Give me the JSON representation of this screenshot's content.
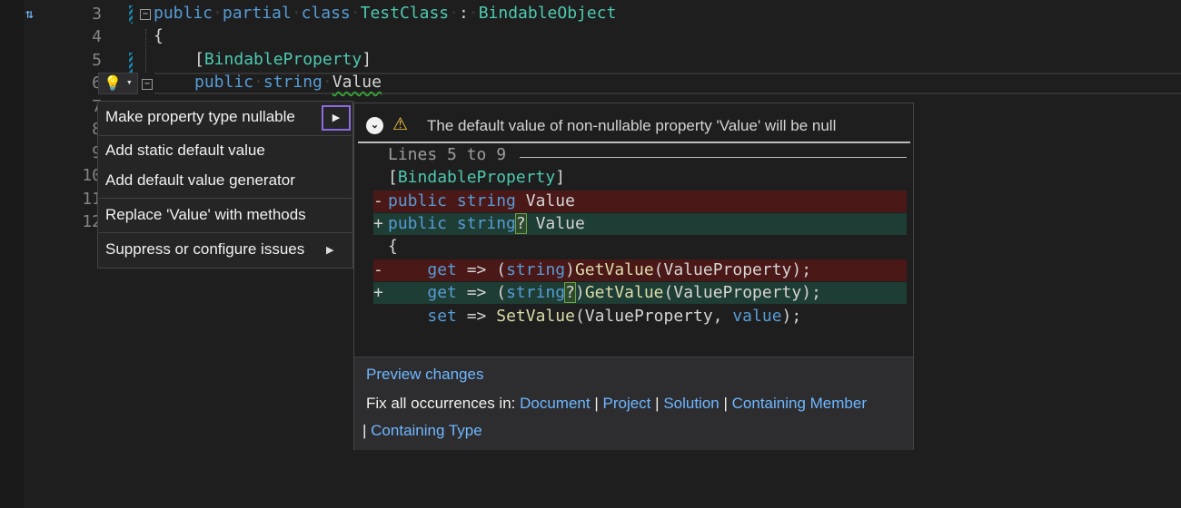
{
  "editor": {
    "line_numbers": [
      "3",
      "4",
      "5",
      "6",
      "7",
      "8",
      "9",
      "10",
      "11",
      "12"
    ],
    "code": {
      "l3": {
        "kw_public": "public",
        "kw_partial": "partial",
        "kw_class": "class",
        "class_name": "TestClass",
        "colon": ":",
        "base_type": "BindableObject"
      },
      "l4": {
        "brace": "{"
      },
      "l5": {
        "open": "[",
        "attr": "BindableProperty",
        "close": "]"
      },
      "l6": {
        "kw_public": "public",
        "kw_string": "string",
        "name": "Value"
      }
    }
  },
  "lightbulb": {
    "icon": "lightbulb-icon",
    "caret": "▾"
  },
  "quick_actions": {
    "items": [
      {
        "label": "Make property type nullable",
        "has_submenu": true
      },
      {
        "label": "Add static default value"
      },
      {
        "label": "Add default value generator"
      },
      {
        "label": "Replace 'Value' with methods"
      },
      {
        "label": "Suppress or configure issues",
        "has_submenu": true
      }
    ],
    "arrow": "▶"
  },
  "preview": {
    "diagnostic": "The default value of non-nullable property 'Value' will be null",
    "lines_caption": "Lines 5 to 9",
    "code": {
      "attr_open": "[",
      "attr_name": "BindableProperty",
      "attr_close": "]",
      "del1_sign": "-",
      "del1_public": "public",
      "del1_string": "string",
      "del1_name": "Value",
      "add1_sign": "+",
      "add1_public": "public",
      "add1_string": "string",
      "add1_q": "?",
      "add1_name": "Value",
      "brace": "{",
      "del2_sign": "-",
      "del2_get": "get",
      "del2_arrow": "=>",
      "del2_po": "(",
      "del2_string": "string",
      "del2_pc": ")",
      "del2_method": "GetValue",
      "del2_args": "(ValueProperty);",
      "add2_sign": "+",
      "add2_get": "get",
      "add2_arrow": "=>",
      "add2_po": "(",
      "add2_string": "string",
      "add2_q": "?",
      "add2_pc": ")",
      "add2_method": "GetValue",
      "add2_args": "(ValueProperty);",
      "set_kw": "set",
      "set_arrow": "=>",
      "set_method": "SetValue",
      "set_args_open": "(ValueProperty, ",
      "set_value": "value",
      "set_args_close": ");"
    },
    "preview_changes_label": "Preview changes",
    "fix_all_label": "Fix all occurrences in:",
    "scopes": [
      "Document",
      "Project",
      "Solution",
      "Containing Member",
      "Containing Type"
    ],
    "separator": "|"
  }
}
